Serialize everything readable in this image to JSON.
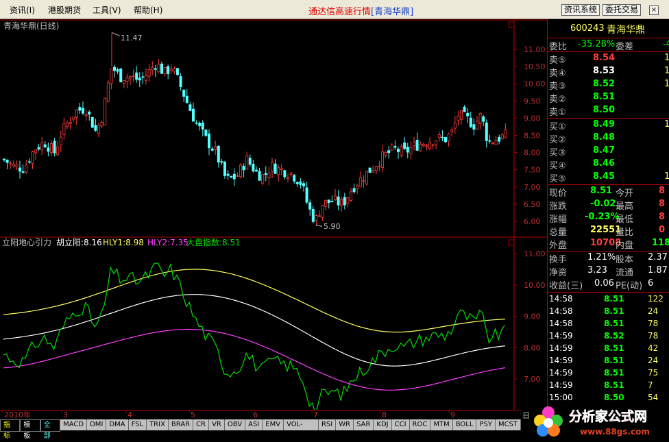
{
  "menu": {
    "items": [
      "资讯(I)",
      "港股期货",
      "工具(V)",
      "帮助(H)"
    ],
    "app_title": "通达信高速行情",
    "app_title_stock": "[青海华鼎]",
    "btn_info": "资讯系统",
    "btn_trade": "委托交易"
  },
  "kline": {
    "title": "青海华鼎(日线)",
    "high_label": "11.47",
    "low_label": "5.90",
    "y_ticks": [
      "11.00",
      "10.50",
      "10.00",
      "9.50",
      "9.00",
      "8.50",
      "8.00",
      "7.50",
      "7.00",
      "6.50",
      "6.00"
    ]
  },
  "indicator": {
    "name": "立阳地心引力",
    "hu": "胡立阳:8.16",
    "hly1": "HLY1:8.98",
    "hly2": "HLY2:7.35",
    "dapan": "大盘指数:8.51",
    "y_ticks": [
      "11.00",
      "10.00",
      "9.00",
      "8.00",
      "7.00"
    ]
  },
  "x_axis": {
    "labels": [
      "2010年",
      "3",
      "4",
      "5",
      "6",
      "7",
      "8",
      "9"
    ],
    "day_label": "日"
  },
  "tabs": [
    "指标",
    "模板",
    "全部",
    "MACD",
    "DMI",
    "DMA",
    "FSL",
    "TRIX",
    "BRAR",
    "CR",
    "VR",
    "OBV",
    "ASI",
    "EMV",
    "VOL-TDX",
    "RSI",
    "WR",
    "SAR",
    "KDJ",
    "CCI",
    "ROC",
    "MTM",
    "BOLL",
    "PSY",
    "MCST"
  ],
  "panel": {
    "code": "600243",
    "name": "青海华鼎",
    "weibi_label": "委比",
    "weibi_value": "-35.28%",
    "weicha_label": "委差",
    "weicha_value": "-4",
    "sells": [
      {
        "label": "卖⑤",
        "price": "8.54",
        "vol": "1"
      },
      {
        "label": "卖④",
        "price": "8.53",
        "vol": "1"
      },
      {
        "label": "卖③",
        "price": "8.52",
        "vol": "1"
      },
      {
        "label": "卖②",
        "price": "8.51",
        "vol": ""
      },
      {
        "label": "卖①",
        "price": "8.50",
        "vol": ""
      }
    ],
    "buys": [
      {
        "label": "买①",
        "price": "8.49",
        "vol": "1"
      },
      {
        "label": "买②",
        "price": "8.48",
        "vol": ""
      },
      {
        "label": "买③",
        "price": "8.47",
        "vol": ""
      },
      {
        "label": "买④",
        "price": "8.46",
        "vol": ""
      },
      {
        "label": "买⑤",
        "price": "8.45",
        "vol": "1"
      }
    ],
    "stats1": [
      {
        "l1": "现价",
        "v1": "8.51",
        "l2": "今开",
        "v2": "8"
      },
      {
        "l1": "涨跌",
        "v1": "-0.02",
        "l2": "最高",
        "v2": "8"
      },
      {
        "l1": "涨幅",
        "v1": "-0.23%",
        "l2": "最低",
        "v2": "8"
      },
      {
        "l1": "总量",
        "v1": "22551",
        "l2": "量比",
        "v2": "0"
      },
      {
        "l1": "外盘",
        "v1": "10708",
        "l2": "内盘",
        "v2": "118"
      }
    ],
    "stats2": [
      {
        "l1": "换手",
        "v1": "1.21%",
        "l2": "股本",
        "v2": "2.37"
      },
      {
        "l1": "净资",
        "v1": "3.23",
        "l2": "流通",
        "v2": "1.87"
      },
      {
        "l1": "收益(三)",
        "v1": "0.06",
        "l2": "PE(动)",
        "v2": "6"
      }
    ],
    "ticks": [
      {
        "time": "14:58",
        "price": "8.51",
        "vol": "122"
      },
      {
        "time": "14:58",
        "price": "8.51",
        "vol": "24"
      },
      {
        "time": "14:58",
        "price": "8.51",
        "vol": "78"
      },
      {
        "time": "14:59",
        "price": "8.52",
        "vol": "78"
      },
      {
        "time": "14:59",
        "price": "8.51",
        "vol": "42"
      },
      {
        "time": "14:59",
        "price": "8.51",
        "vol": "24"
      },
      {
        "time": "14:59",
        "price": "8.51",
        "vol": "75"
      },
      {
        "time": "14:59",
        "price": "8.51",
        "vol": "7"
      },
      {
        "time": "15:00",
        "price": "8.50",
        "vol": "54"
      }
    ]
  },
  "watermark": {
    "text": "分析家公式网",
    "url": "www.88gs.com"
  },
  "colors": {
    "up": "#ff3c3c",
    "down": "#54ffff",
    "green": "#00e000",
    "yellow": "#ffff60",
    "white": "#ffffff",
    "magenta": "#ff40ff",
    "grid": "#b00000",
    "price_green": "#00ff00",
    "label_gray": "#c0c0c0"
  }
}
